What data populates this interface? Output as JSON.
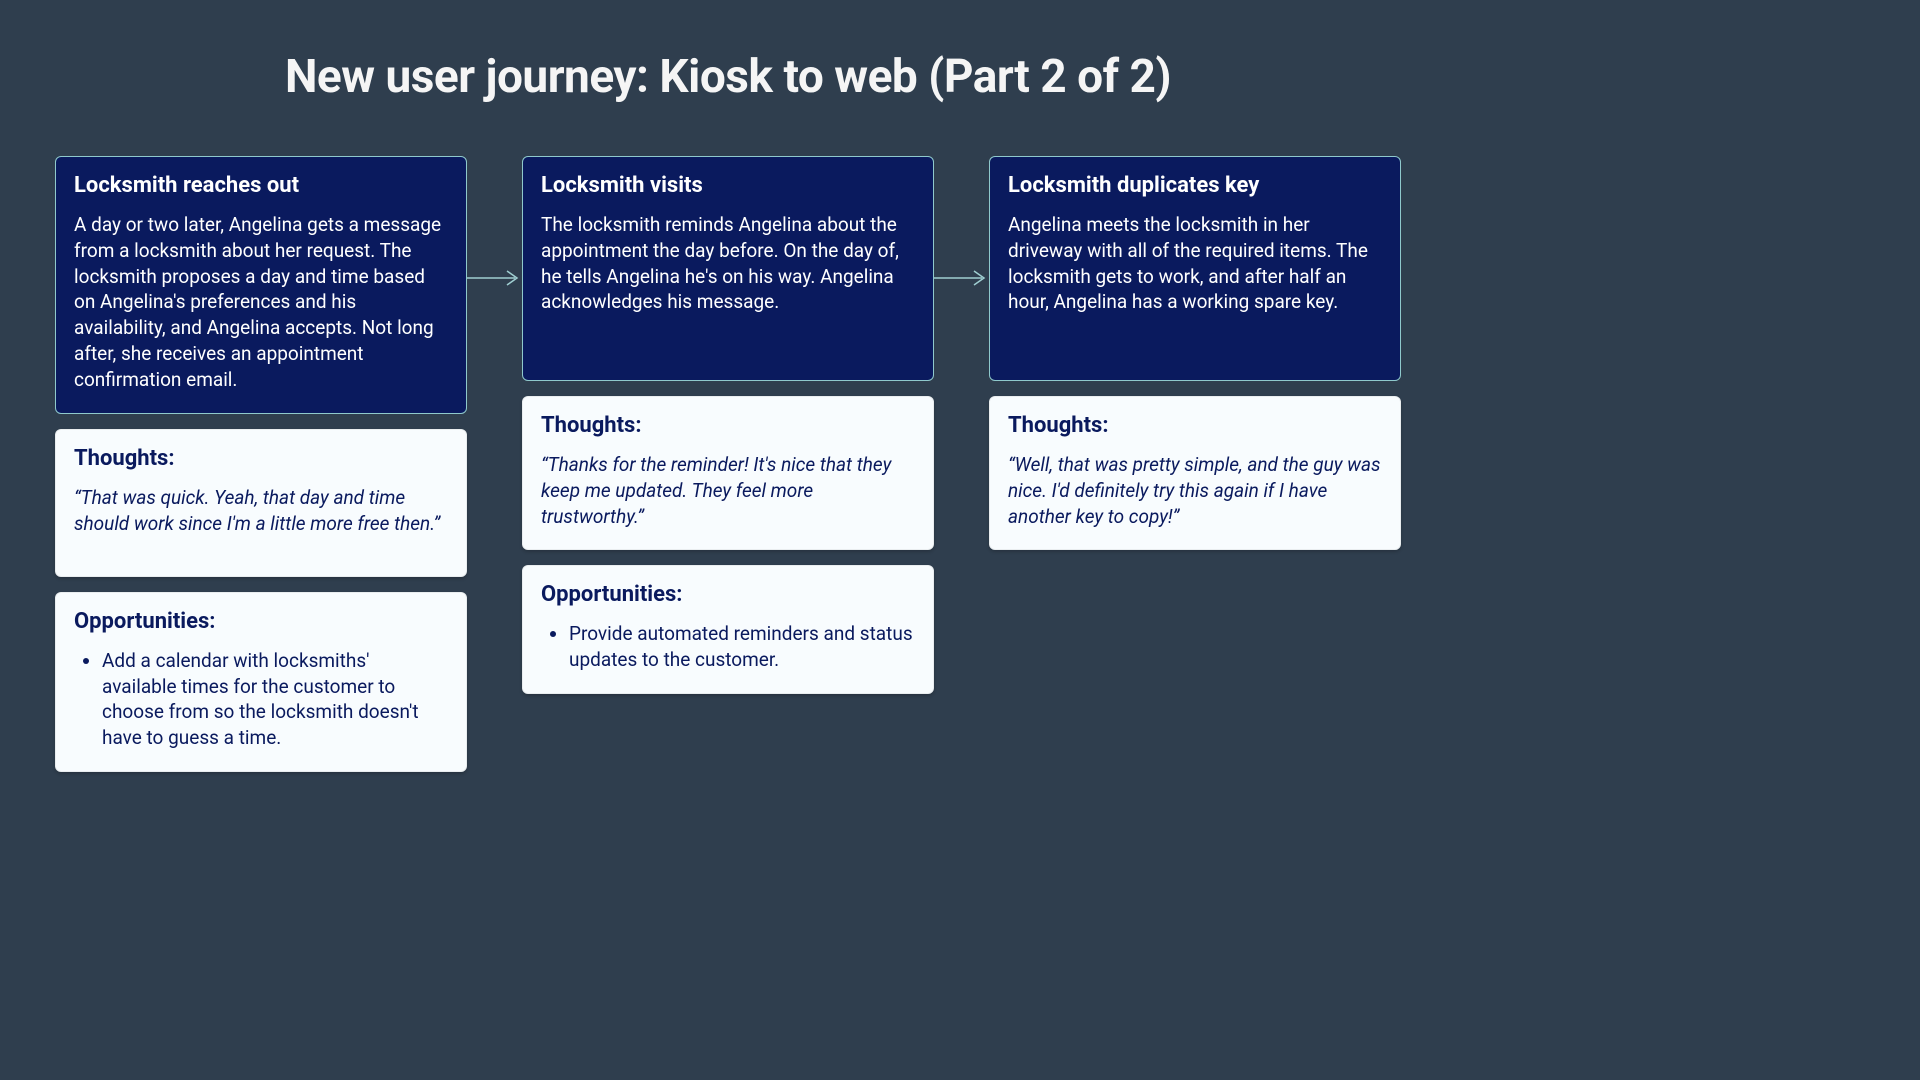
{
  "title": "New user journey: Kiosk to web (Part 2 of 2)",
  "labels": {
    "thoughts": "Thoughts:",
    "opportunities": "Opportunities:"
  },
  "stages": [
    {
      "title": "Locksmith reaches out",
      "body": "A day or two later, Angelina gets a message from a locksmith about her request. The locksmith proposes a day and time based on Angelina's preferences and his availability, and Angelina accepts. Not long after, she receives an appointment confirmation email.",
      "thoughts": "“That was quick. Yeah, that day and time should work since I'm a little more free then.”",
      "opportunities": [
        "Add a calendar with locksmiths' available times for the customer to choose from so the locksmith doesn't have to guess a time."
      ]
    },
    {
      "title": "Locksmith visits",
      "body": "The locksmith reminds Angelina about the appointment the day before. On the day of, he tells Angelina he's on his way. Angelina acknowledges his message.",
      "thoughts": "“Thanks for the reminder! It's nice that they keep me updated. They feel more trustworthy.”",
      "opportunities": [
        "Provide automated reminders and status updates to the customer."
      ]
    },
    {
      "title": "Locksmith duplicates key",
      "body": "Angelina meets the locksmith in her driveway with all of the required items. The locksmith gets to work, and after half an hour, Angelina has a working spare key.",
      "thoughts": "“Well, that was pretty simple, and the guy was nice. I'd definitely try this again if I have another key to copy!”",
      "opportunities": []
    }
  ]
}
